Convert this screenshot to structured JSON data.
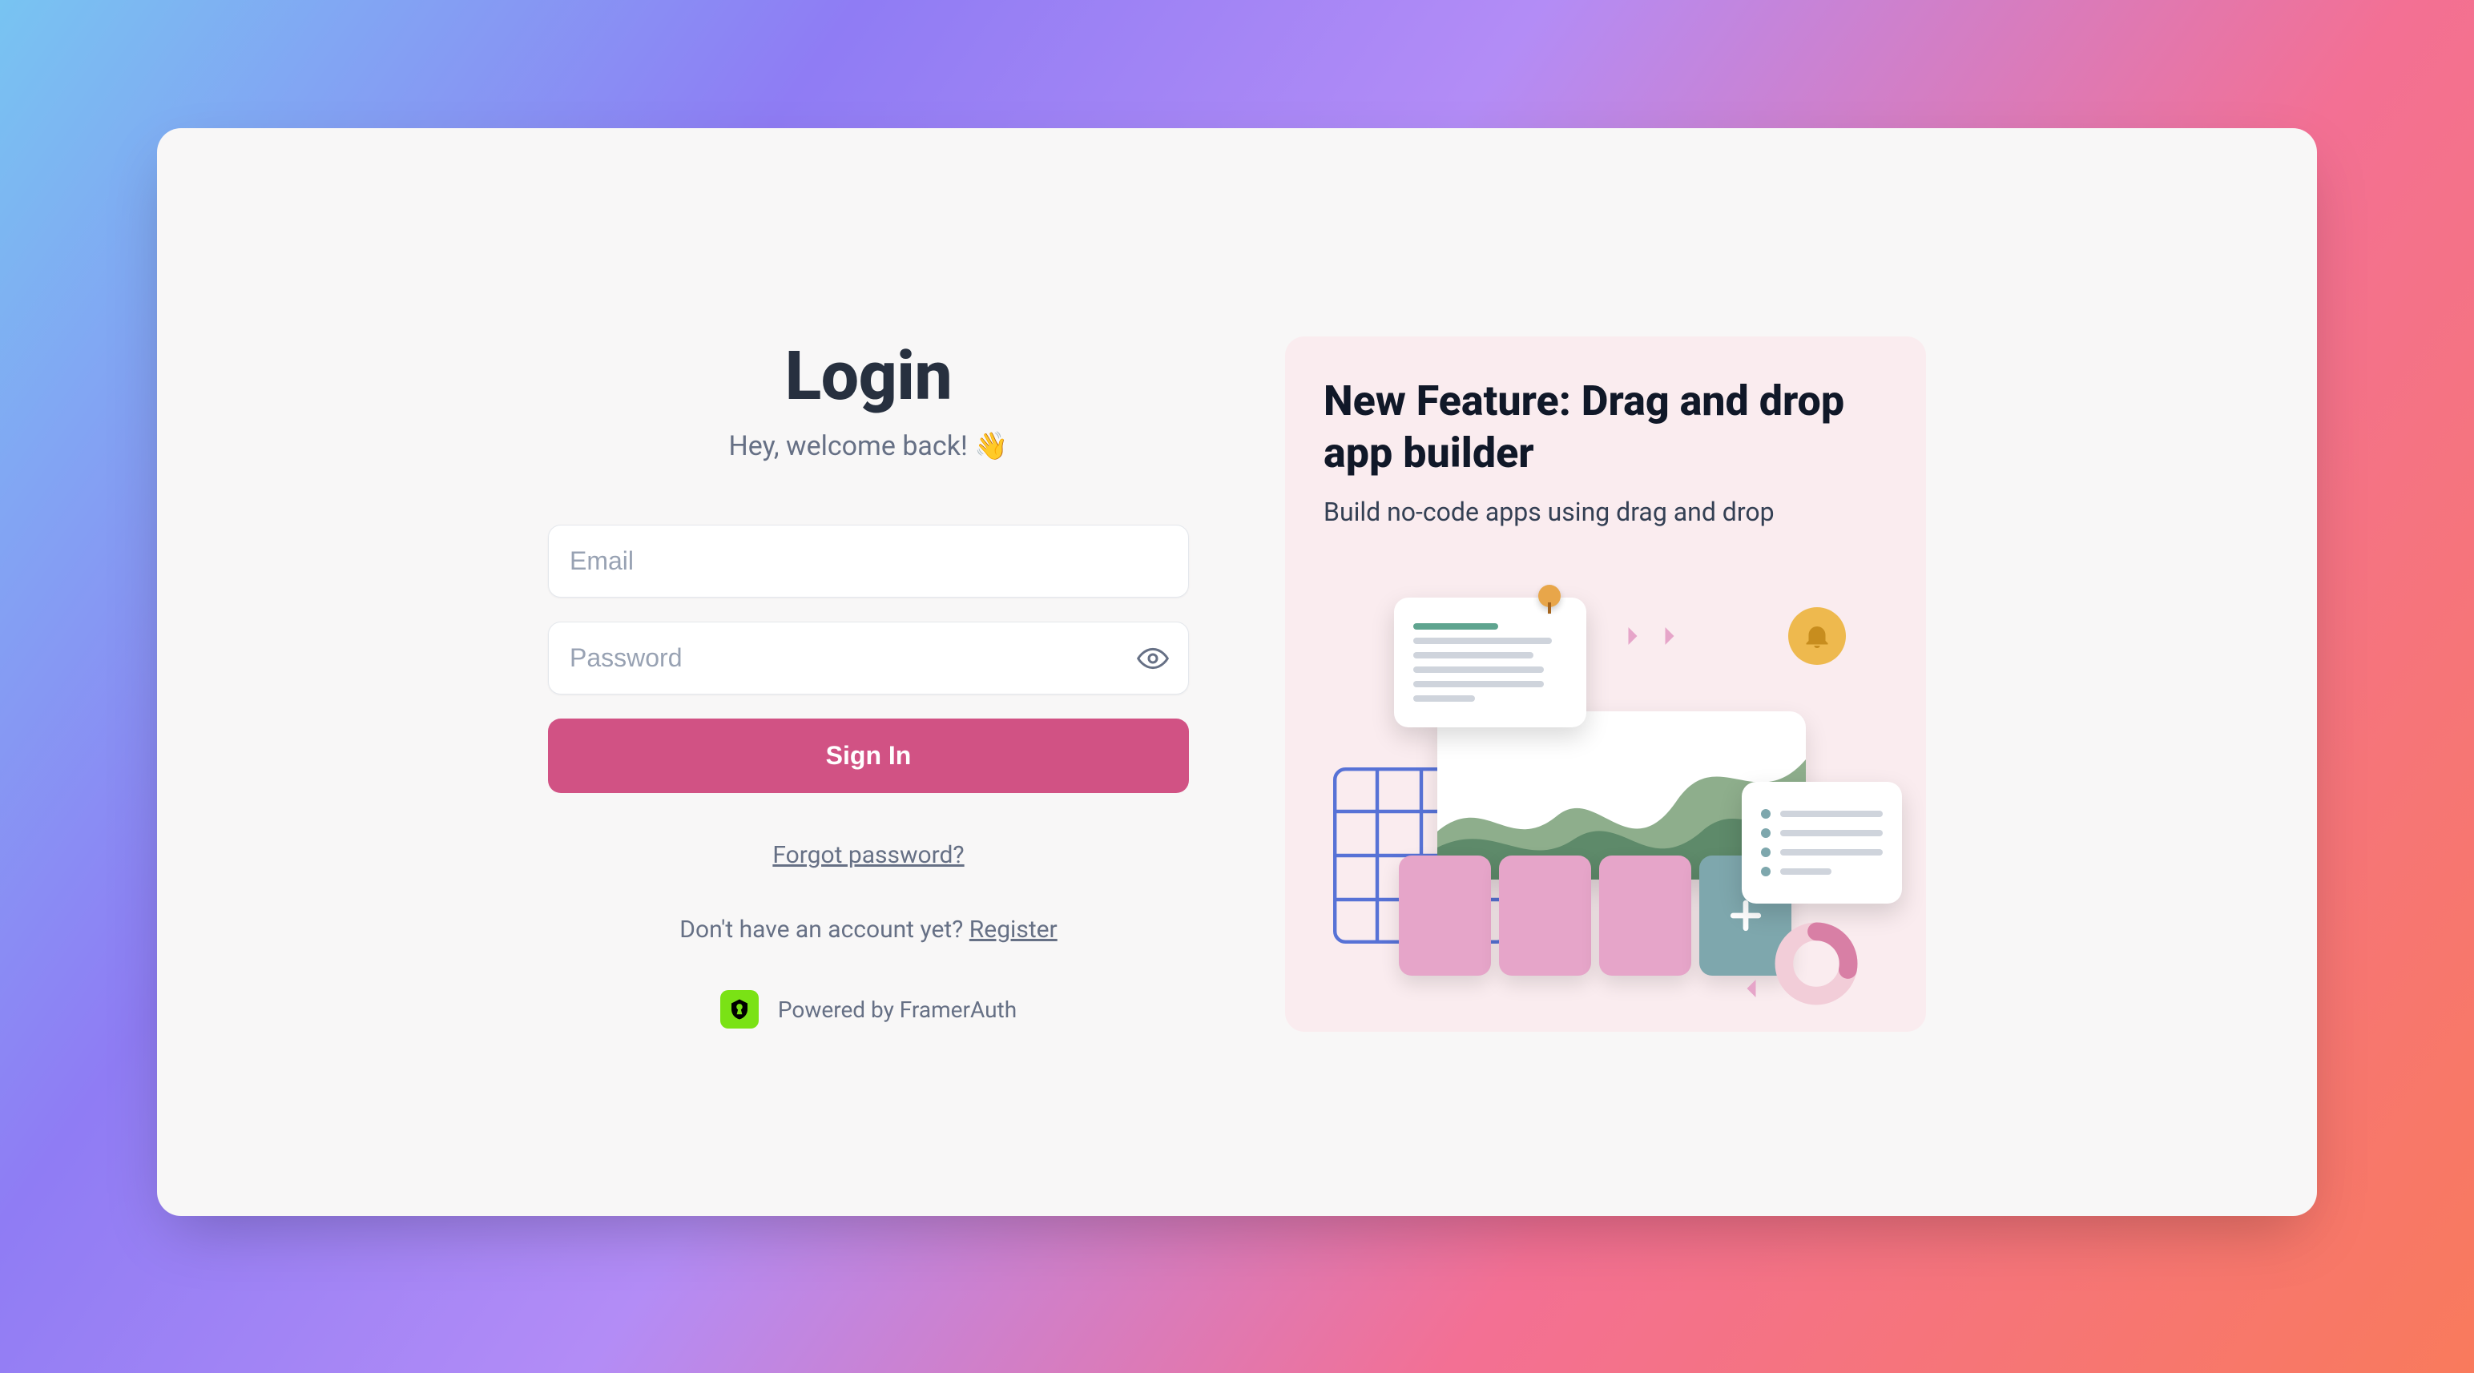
{
  "login": {
    "title": "Login",
    "subtitle": "Hey, welcome back! 👋",
    "email_placeholder": "Email",
    "password_placeholder": "Password",
    "signin_label": "Sign In",
    "forgot_label": "Forgot password?",
    "noacct_text": "Don't have an account yet? ",
    "register_label": "Register",
    "powered_text": "Powered by FramerAuth"
  },
  "feature": {
    "title": "New Feature: Drag and drop app builder",
    "subtitle": "Build no-code apps using drag and drop"
  }
}
